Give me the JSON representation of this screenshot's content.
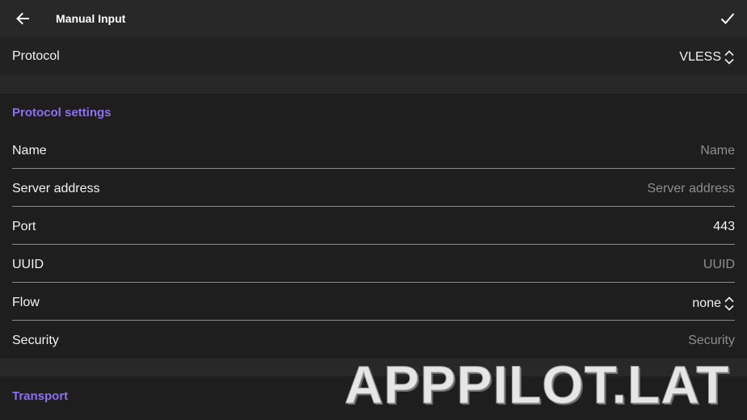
{
  "header": {
    "title": "Manual Input",
    "back_icon": "arrow-left-icon",
    "confirm_icon": "check-icon"
  },
  "protocol": {
    "label": "Protocol",
    "value": "VLESS"
  },
  "protocol_settings": {
    "title": "Protocol settings",
    "fields": {
      "name": {
        "label": "Name",
        "placeholder": "Name"
      },
      "server_address": {
        "label": "Server address",
        "placeholder": "Server address"
      },
      "port": {
        "label": "Port",
        "value": "443"
      },
      "uuid": {
        "label": "UUID",
        "placeholder": "UUID"
      },
      "flow": {
        "label": "Flow",
        "value": "none"
      },
      "security": {
        "label": "Security",
        "placeholder": "Security"
      }
    }
  },
  "transport": {
    "title": "Transport"
  },
  "watermark": "APPPILOT.LAT",
  "colors": {
    "accent": "#8d6ff0",
    "background": "#1e1e1e",
    "toolbar": "#282828",
    "divider": "#8a8a8a",
    "placeholder": "#8e8e8e"
  }
}
